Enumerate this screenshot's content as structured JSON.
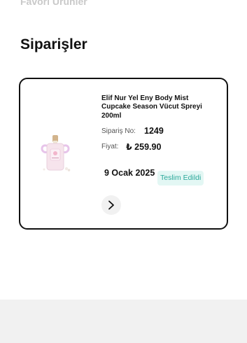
{
  "favorites_header": {
    "title": "Favori Ürünler"
  },
  "orders_section": {
    "title": "Siparişler"
  },
  "order": {
    "product_name": "Elif Nur Yel Eny Body Mist Cupcake Season Vücut Spreyi 200ml",
    "order_no_label": "Sipariş No:",
    "order_no": "1249",
    "price_label": "Fiyat:",
    "price": "₺ 259.90",
    "date": "9 Ocak 2025",
    "status": "Teslim Edildi",
    "status_color": "#2ba89a",
    "status_bg": "#e3f7f4",
    "detail_icon": "chevron-right-icon"
  }
}
